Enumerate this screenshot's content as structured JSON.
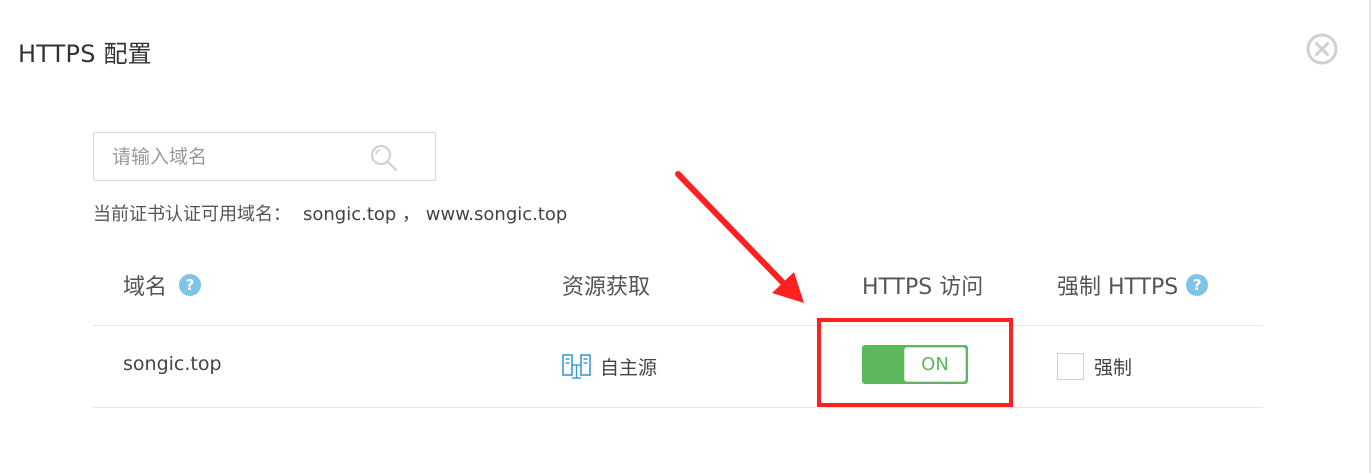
{
  "dialog": {
    "title": "HTTPS 配置"
  },
  "search": {
    "placeholder": "请输入域名",
    "value": ""
  },
  "cert": {
    "label": "当前证书认证可用域名：",
    "domains": "songic.top ， www.songic.top"
  },
  "table": {
    "headers": {
      "domain": "域名",
      "source": "资源获取",
      "https_access": "HTTPS 访问",
      "force_https": "强制 HTTPS"
    },
    "rows": [
      {
        "domain": "songic.top",
        "source": "自主源",
        "https_toggle": "ON",
        "force_label": "强制"
      }
    ]
  },
  "colors": {
    "toggle_on": "#5cb85c",
    "help_icon": "#7ec3e8",
    "annotation_red": "#ff2020"
  },
  "icons": {
    "close": "close-circle-icon",
    "search": "magnifier-icon",
    "help": "question-circle-icon",
    "source": "server-source-icon"
  }
}
